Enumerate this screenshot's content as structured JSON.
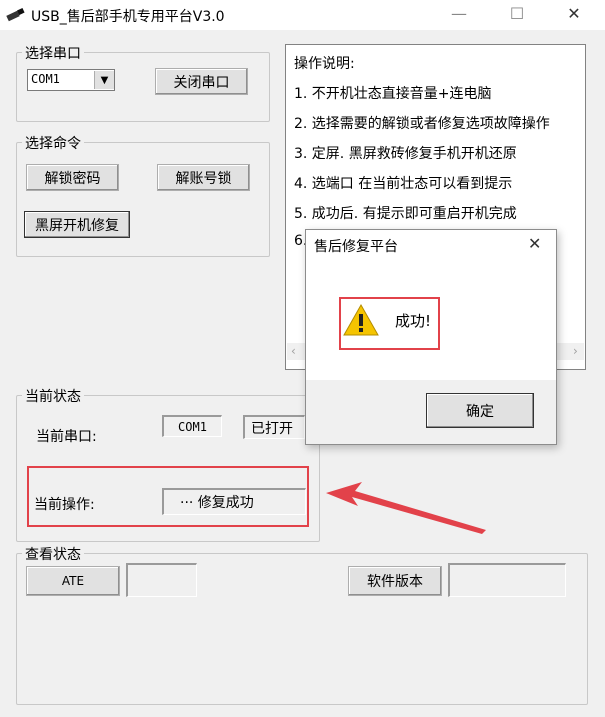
{
  "window": {
    "title": "USB_售后部手机专用平台V3.0",
    "controls": {
      "minimize": "—",
      "maximize": "☐",
      "close": "✕"
    }
  },
  "serial_group": {
    "label": "选择串口",
    "port_select_value": "COM1",
    "close_port_button": "关闭串口"
  },
  "command_group": {
    "label": "选择命令",
    "unlock_password_button": "解锁密码",
    "unlock_account_button": "解账号锁",
    "black_screen_repair_button": "黑屏开机修复"
  },
  "instructions": {
    "title": "操作说明:",
    "lines": [
      "1. 不开机壮态直接音量+连电脑",
      "2. 选择需要的解锁或者修复选项故障操作",
      "3. 定屏. 黑屏救砖修复手机开机还原",
      "4. 选端口  在当前壮态可以看到提示",
      "5. 成功后. 有提示即可重启开机完成",
      "6."
    ]
  },
  "status_group": {
    "label": "当前状态",
    "current_port_label": "当前串口:",
    "current_port_value": "COM1",
    "port_state_value": "已打开",
    "current_op_label": "当前操作:",
    "current_op_value": "··· 修复成功"
  },
  "check_group": {
    "label": "查看状态",
    "ate_button": "ATE",
    "ate_value": "",
    "software_version_button": "软件版本",
    "software_version_value": ""
  },
  "dialog": {
    "title": "售后修复平台",
    "message": "成功!",
    "ok_button": "确定",
    "close_icon": "✕"
  },
  "colors": {
    "annotation_red": "#e2424a",
    "warning_yellow": "#f5c400"
  }
}
